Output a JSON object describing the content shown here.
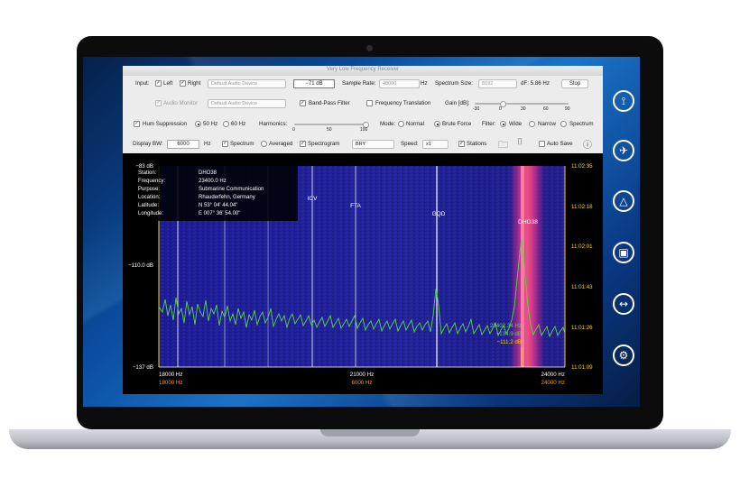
{
  "window": {
    "title": "Very Low Frequency Receiver"
  },
  "row1": {
    "input_label": "Input:",
    "left_label": "Left",
    "right_label": "Right",
    "device": "Default Audio Device",
    "level": "−71 dB",
    "sample_rate_label": "Sample Rate:",
    "sample_rate": "48000",
    "hz": "Hz",
    "spectrum_size_label": "Spectrum Size:",
    "spectrum_size": "8192",
    "df": "dF: 5.86 Hz",
    "stop_label": "Stop"
  },
  "row2": {
    "audio_monitor_label": "Audio Monitor",
    "device": "Default Audio Device",
    "bandpass_label": "Band-Pass Filter",
    "freq_translation_label": "Frequency Translation",
    "gain_label": "Gain [dB]:",
    "gain_ticks": [
      "-30",
      "0",
      "30",
      "60",
      "90"
    ]
  },
  "row3": {
    "hum_label": "Hum Suppression",
    "hz50": "50 Hz",
    "hz60": "60 Hz",
    "harmonics_label": "Harmonics:",
    "harmonics_ticks": [
      "0",
      "50",
      "100"
    ],
    "mode_label": "Mode:",
    "mode_normal": "Normal",
    "mode_brute": "Brute Force",
    "filter_label": "Filter:",
    "filter_wide": "Wide",
    "filter_narrow": "Narrow",
    "filter_spectrum": "Spectrum"
  },
  "row4": {
    "display_bw_label": "Display BW:",
    "display_bw": "6000",
    "hz": "Hz",
    "spectrum_label": "Spectrum",
    "averaged_label": "Averaged",
    "spectrogram_label": "Spectrogram",
    "colormap": "BRY",
    "speed_label": "Speed:",
    "speed": "x1",
    "stations_label": "Stations",
    "autosave_label": "Auto Save"
  },
  "plot": {
    "y_top": "−83 dB",
    "y_mid": "−110.0 dB",
    "y_bottom": "−137 dB",
    "x_left": "18000 Hz",
    "x_mid": "21000 Hz",
    "x_right": "24000 Hz",
    "x_left_sub": "18000 Hz",
    "x_mid_sub": "6000 Hz",
    "x_right_sub": "24000 Hz",
    "times": [
      "11:02:35",
      "11:02:18",
      "11:02:01",
      "11:01:43",
      "11:01:26",
      "11:01:09"
    ],
    "stations": [
      "ICV",
      "FTA",
      "GQD",
      "DHO38"
    ],
    "info": [
      {
        "k": "Station:",
        "v": "DHO38"
      },
      {
        "k": "Frequency:",
        "v": "23400.0 Hz"
      },
      {
        "k": "Purpose:",
        "v": "Submarine Communication"
      },
      {
        "k": "Location:",
        "v": "Rhauderfehn, Germany"
      },
      {
        "k": "Latitude:",
        "v": "N 53° 04' 44.04\""
      },
      {
        "k": "Longitude:",
        "v": "E 007° 36' 54.00\""
      }
    ],
    "cursor": {
      "freq": "23402.34 Hz",
      "db1": "−134.9 dB",
      "db2": "−111.2 dB"
    }
  },
  "side_icons": [
    "antenna-icon",
    "satellite-icon",
    "triangle-badge-icon",
    "toolbox-icon",
    "signal-arrows-icon",
    "gears-icon"
  ]
}
